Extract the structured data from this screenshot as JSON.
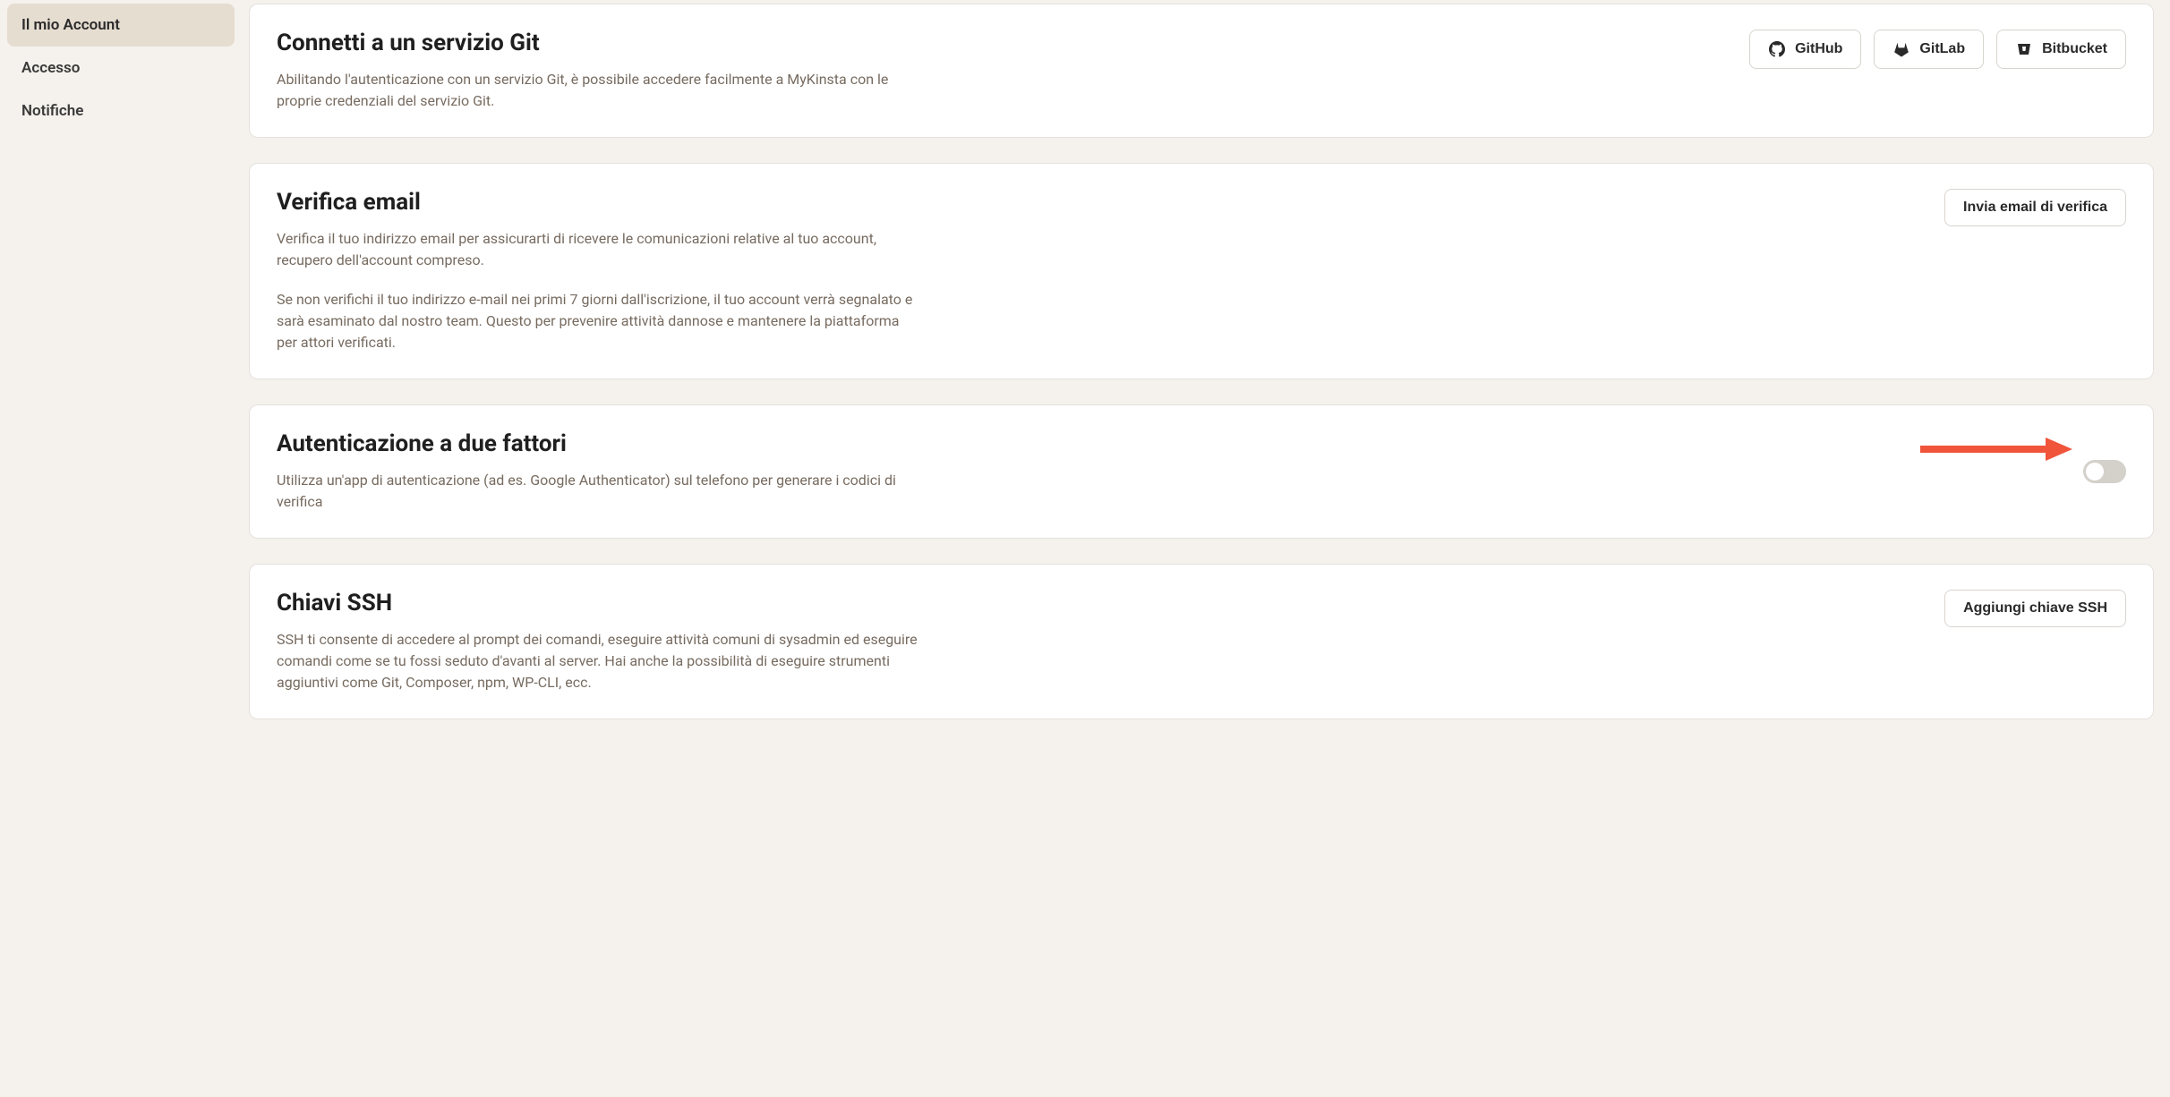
{
  "sidebar": {
    "items": [
      {
        "label": "Il mio Account",
        "active": true
      },
      {
        "label": "Accesso",
        "active": false
      },
      {
        "label": "Notifiche",
        "active": false
      }
    ]
  },
  "git": {
    "title": "Connetti a un servizio Git",
    "desc": "Abilitando l'autenticazione con un servizio Git, è possibile accedere facilmente a MyKinsta con le proprie credenziali del servizio Git.",
    "buttons": {
      "github": "GitHub",
      "gitlab": "GitLab",
      "bitbucket": "Bitbucket"
    }
  },
  "emailVerify": {
    "title": "Verifica email",
    "desc1": "Verifica il tuo indirizzo email per assicurarti di ricevere le comunicazioni relative al tuo account, recupero dell'account compreso.",
    "desc2": "Se non verifichi il tuo indirizzo e-mail nei primi 7 giorni dall'iscrizione, il tuo account verrà segnalato e sarà esaminato dal nostro team. Questo per prevenire attività dannose e mantenere la piattaforma per attori verificati.",
    "button": "Invia email di verifica"
  },
  "twofa": {
    "title": "Autenticazione a due fattori",
    "desc": "Utilizza un'app di autenticazione (ad es. Google Authenticator) sul telefono per generare i codici di verifica"
  },
  "ssh": {
    "title": "Chiavi SSH",
    "desc": "SSH ti consente di accedere al prompt dei comandi, eseguire attività comuni di sysadmin ed eseguire comandi come se tu fossi seduto d'avanti al server. Hai anche la possibilità di eseguire strumenti aggiuntivi come Git, Composer, npm, WP-CLI, ecc.",
    "button": "Aggiungi chiave SSH"
  }
}
